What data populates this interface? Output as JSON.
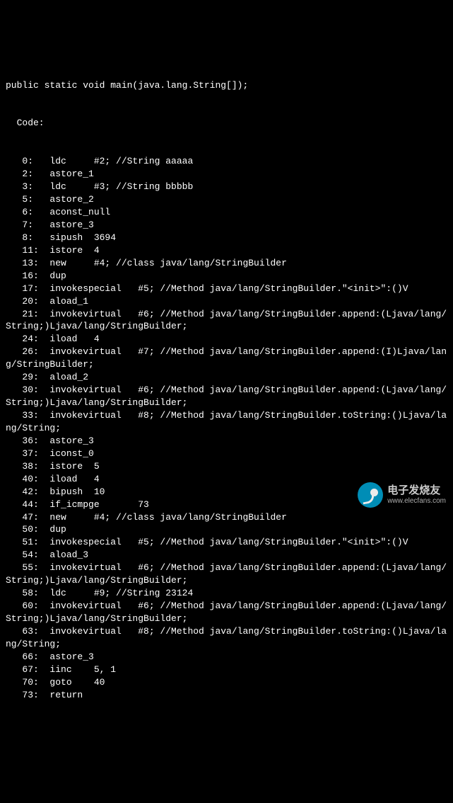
{
  "signature": "public static void main(java.lang.String[]);",
  "code_label": "  Code:",
  "lines": [
    "   0:   ldc     #2; //String aaaaa",
    "   2:   astore_1",
    "   3:   ldc     #3; //String bbbbb",
    "   5:   astore_2",
    "   6:   aconst_null",
    "   7:   astore_3",
    "   8:   sipush  3694",
    "   11:  istore  4",
    "   13:  new     #4; //class java/lang/StringBuilder",
    "   16:  dup",
    "   17:  invokespecial   #5; //Method java/lang/StringBuilder.\"<init>\":()V",
    "   20:  aload_1",
    "   21:  invokevirtual   #6; //Method java/lang/StringBuilder.append:(Ljava/lang/\nString;)Ljava/lang/StringBuilder;",
    "   24:  iload   4",
    "   26:  invokevirtual   #7; //Method java/lang/StringBuilder.append:(I)Ljava/lan\ng/StringBuilder;",
    "   29:  aload_2",
    "   30:  invokevirtual   #6; //Method java/lang/StringBuilder.append:(Ljava/lang/\nString;)Ljava/lang/StringBuilder;",
    "   33:  invokevirtual   #8; //Method java/lang/StringBuilder.toString:()Ljava/la\nng/String;",
    "   36:  astore_3",
    "   37:  iconst_0",
    "   38:  istore  5",
    "   40:  iload   4",
    "   42:  bipush  10",
    "   44:  if_icmpge       73",
    "   47:  new     #4; //class java/lang/StringBuilder",
    "   50:  dup",
    "   51:  invokespecial   #5; //Method java/lang/StringBuilder.\"<init>\":()V",
    "   54:  aload_3",
    "   55:  invokevirtual   #6; //Method java/lang/StringBuilder.append:(Ljava/lang/\nString;)Ljava/lang/StringBuilder;",
    "   58:  ldc     #9; //String 23124",
    "   60:  invokevirtual   #6; //Method java/lang/StringBuilder.append:(Ljava/lang/\nString;)Ljava/lang/StringBuilder;",
    "   63:  invokevirtual   #8; //Method java/lang/StringBuilder.toString:()Ljava/la\nng/String;",
    "   66:  astore_3",
    "   67:  iinc    5, 1",
    "   70:  goto    40",
    "   73:  return"
  ],
  "watermark": {
    "brand_cn": "电子发烧友",
    "url": "www.elecfans.com"
  }
}
